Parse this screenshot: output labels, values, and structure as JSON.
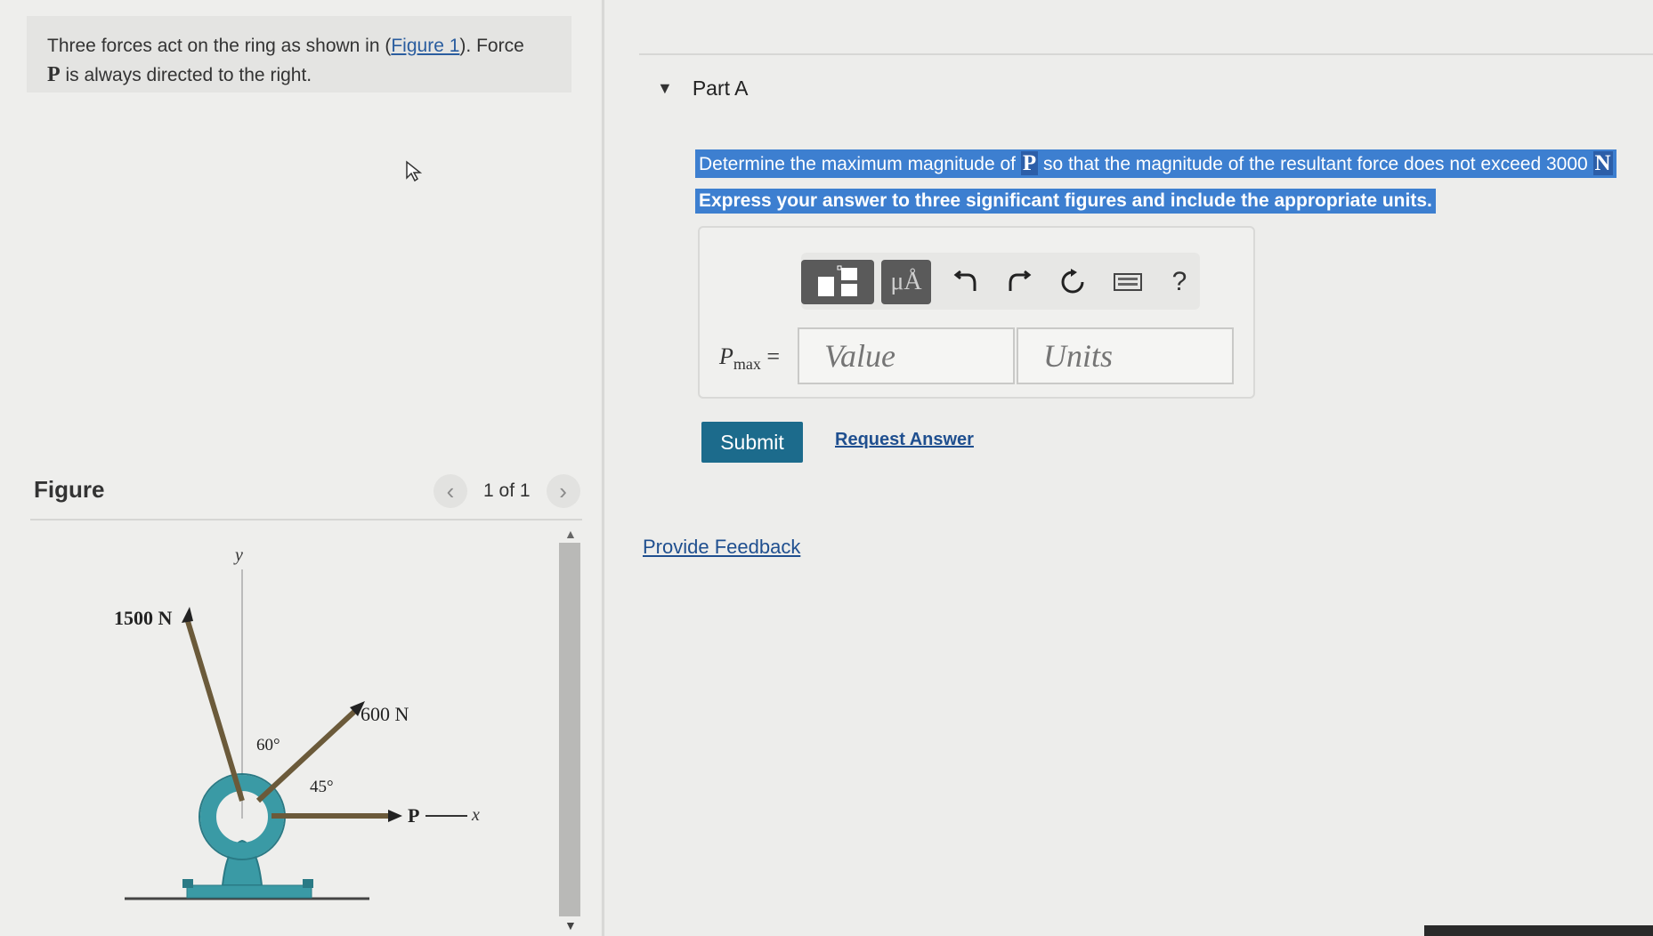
{
  "problem": {
    "text_before_link": "Three forces act on the ring as shown in (",
    "link": "Figure 1",
    "text_after_link": "). Force",
    "bold_var": "P",
    "line2": " is always directed to the right."
  },
  "figure_panel": {
    "label": "Figure",
    "pager": "1 of 1",
    "labels": {
      "y_axis": "y",
      "x_axis": "x",
      "force1": "1500 N",
      "force2": "600 N",
      "force3": "P",
      "angle1": "60°",
      "angle2": "45°"
    }
  },
  "part": {
    "title": "Part A",
    "question_pre": "Determine the maximum magnitude of ",
    "question_var": "P",
    "question_post": " so that the magnitude of the resultant force does not exceed 3000 ",
    "question_unit": "N",
    "instruction": "Express your answer to three significant figures and include the appropriate units."
  },
  "toolbar": {
    "mu_label": "μÅ",
    "help_label": "?",
    "icons": [
      "template-icon",
      "mu-angstrom-icon",
      "undo-icon",
      "redo-icon",
      "reset-icon",
      "keyboard-icon",
      "help-icon"
    ]
  },
  "answer": {
    "var_main": "P",
    "var_sub": "max",
    "equals": "=",
    "value_placeholder": "Value",
    "units_placeholder": "Units"
  },
  "actions": {
    "submit": "Submit",
    "request_answer": "Request Answer",
    "feedback": "Provide Feedback"
  },
  "colors": {
    "highlight": "#3d7fd0",
    "submit": "#1c6b8c",
    "link": "#1f4f8f",
    "support": "#3a9aa5"
  }
}
